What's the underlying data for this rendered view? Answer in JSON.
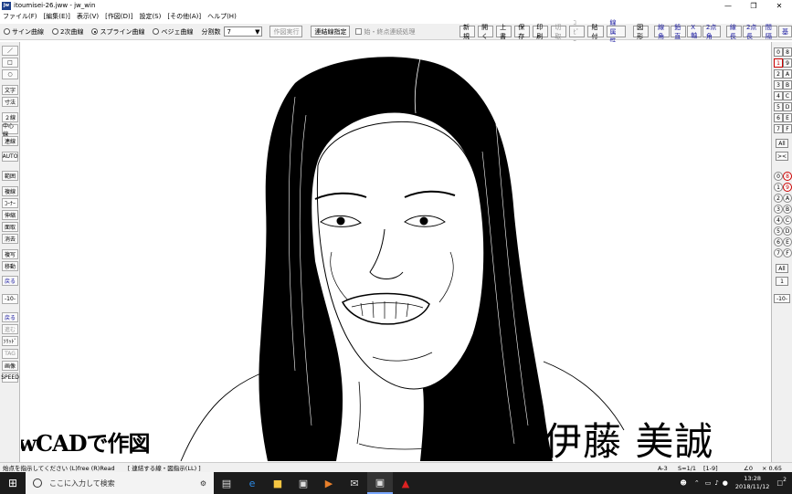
{
  "window": {
    "title": "itoumisei-26.jww - jw_win",
    "app_icon_text": "jw"
  },
  "menu": [
    "ファイル(F)",
    "[編集(E)]",
    "表示(V)",
    "[作図(D)]",
    "設定(S)",
    "[その他(A)]",
    "ヘルプ(H)"
  ],
  "toolbar": {
    "curve_options": [
      {
        "label": "サイン曲線",
        "selected": false
      },
      {
        "label": "2次曲線",
        "selected": false
      },
      {
        "label": "スプライン曲線",
        "selected": true
      },
      {
        "label": "ベジェ曲線",
        "selected": false
      }
    ],
    "division_label": "分割数",
    "division_value": "7",
    "exec_label": "作図実行",
    "connect_label": "連結線指定",
    "option_check_label": "始・終点連続処理",
    "right_buttons": [
      {
        "label": "新規",
        "state": "normal"
      },
      {
        "label": "開く",
        "state": "normal"
      },
      {
        "label": "上書",
        "state": "normal"
      },
      {
        "label": "保存",
        "state": "normal"
      },
      {
        "label": "印刷",
        "state": "normal"
      },
      {
        "label": "切取",
        "state": "disabled"
      },
      {
        "label": "ｺﾋﾟｰ",
        "state": "disabled"
      },
      {
        "label": "貼付",
        "state": "normal"
      },
      {
        "label": "線属性",
        "state": "blue"
      },
      {
        "label": "図形",
        "state": "normal"
      },
      {
        "label": "線角",
        "state": "blue"
      },
      {
        "label": "鉛直",
        "state": "blue"
      },
      {
        "label": "X軸",
        "state": "blue"
      },
      {
        "label": "2点角",
        "state": "blue"
      },
      {
        "label": "線長",
        "state": "blue"
      },
      {
        "label": "2点長",
        "state": "blue"
      },
      {
        "label": "間隔",
        "state": "blue"
      },
      {
        "label": "基",
        "state": "blue"
      }
    ]
  },
  "left_tools": [
    {
      "label": "／",
      "state": "normal"
    },
    {
      "label": "□",
      "state": "normal"
    },
    {
      "label": "○",
      "state": "normal"
    },
    {
      "label": "文字",
      "state": "normal"
    },
    {
      "label": "寸法",
      "state": "normal"
    },
    {
      "label": "２線",
      "state": "normal"
    },
    {
      "label": "中心線",
      "state": "normal"
    },
    {
      "label": "連線",
      "state": "normal"
    },
    {
      "label": "AUTO",
      "state": "normal"
    },
    {
      "label": "範囲",
      "state": "normal"
    },
    {
      "label": "複線",
      "state": "normal"
    },
    {
      "label": "ｺｰﾅｰ",
      "state": "normal"
    },
    {
      "label": "伸縮",
      "state": "normal"
    },
    {
      "label": "面取",
      "state": "normal"
    },
    {
      "label": "消去",
      "state": "normal"
    },
    {
      "label": "複写",
      "state": "normal"
    },
    {
      "label": "移動",
      "state": "normal"
    },
    {
      "label": "戻る",
      "state": "blue"
    },
    {
      "label": "-10-",
      "state": "normal"
    },
    {
      "label": "戻る",
      "state": "blue"
    },
    {
      "label": "進む",
      "state": "disabled"
    },
    {
      "label": "ｿﾘｯﾄﾞ",
      "state": "normal"
    },
    {
      "label": "TAG",
      "state": "disabled"
    },
    {
      "label": "画像",
      "state": "normal"
    },
    {
      "label": "SPEED",
      "state": "normal"
    }
  ],
  "right_layers": {
    "layer_rows": [
      [
        "0",
        "8"
      ],
      [
        "1",
        "9"
      ],
      [
        "2",
        "A"
      ],
      [
        "3",
        "B"
      ],
      [
        "4",
        "C"
      ],
      [
        "5",
        "D"
      ],
      [
        "6",
        "E"
      ],
      [
        "7",
        "F"
      ]
    ],
    "all_label": "All",
    "x_label": "><",
    "group_rows": [
      [
        "0",
        "8"
      ],
      [
        "1",
        "9"
      ],
      [
        "2",
        "A"
      ],
      [
        "3",
        "B"
      ],
      [
        "4",
        "C"
      ],
      [
        "5",
        "D"
      ],
      [
        "6",
        "E"
      ],
      [
        "7",
        "F"
      ]
    ],
    "all_label_2": "All",
    "one_label": "1",
    "ten_label": "-10-"
  },
  "canvas": {
    "caption_left": "JwCADで作図",
    "caption_right": "伊藤 美誠"
  },
  "status": {
    "message": "始点を指示してください (L)free (R)Read",
    "hint": "[ 連結する線・図指示(LL) ]",
    "paper": "A-3",
    "scale": "S=1/1",
    "layer": "[1-9]",
    "angle": "∠0",
    "zoom": "× 0.65"
  },
  "taskbar": {
    "search_placeholder": "ここに入力して検索",
    "time": "13:28",
    "date": "2018/11/12",
    "notif_count": "2"
  }
}
